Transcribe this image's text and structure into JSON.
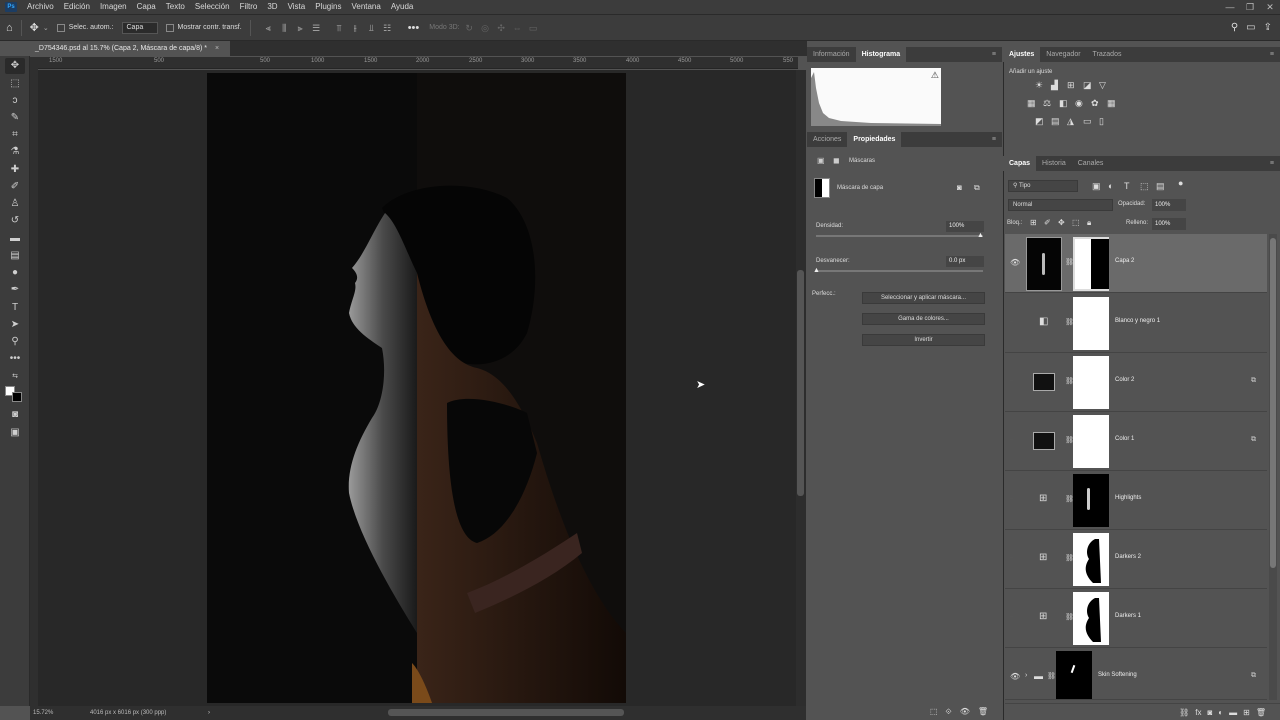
{
  "menu": [
    "Archivo",
    "Edición",
    "Imagen",
    "Capa",
    "Texto",
    "Selección",
    "Filtro",
    "3D",
    "Vista",
    "Plugins",
    "Ventana",
    "Ayuda"
  ],
  "options": {
    "auto_select_label": "Selec. autom.:",
    "auto_select_value": "Capa",
    "transform_label": "Mostrar contr. transf.",
    "mode3d_label": "Modo 3D:"
  },
  "document": {
    "tab_title": "_D754346.psd al 15.7% (Capa 2, Máscara de capa/8) *",
    "ruler_ticks": [
      "1500",
      "500",
      "500",
      "1000",
      "1500",
      "2000",
      "2500",
      "3000",
      "3500",
      "4000",
      "4500",
      "5000",
      "550"
    ]
  },
  "status": {
    "zoom": "15.72%",
    "doc_info": "4016 px x 6016 px (300 ppp)"
  },
  "histogram_panel": {
    "tabs": [
      "Información",
      "Histograma"
    ]
  },
  "properties_panel": {
    "tabs": [
      "Acciones",
      "Propiedades"
    ],
    "section": "Máscaras",
    "mask_label": "Máscara de capa",
    "density_label": "Densidad:",
    "density_value": "100%",
    "feather_label": "Desvanecer:",
    "feather_value": "0.0 px",
    "refine_label": "Perfecc.:",
    "btn_select_mask": "Seleccionar y aplicar máscara...",
    "btn_color_range": "Gama de colores...",
    "btn_invert": "Invertir"
  },
  "adjustments_panel": {
    "tabs": [
      "Ajustes",
      "Navegador",
      "Trazados"
    ],
    "add_label": "Añadir un ajuste"
  },
  "layers_panel": {
    "tabs": [
      "Capas",
      "Historia",
      "Canales"
    ],
    "filter_kind": "Tipo",
    "blend_mode": "Normal",
    "opacity_label": "Opacidad:",
    "opacity_value": "100%",
    "lock_label": "Bloq.:",
    "fill_label": "Relleno:",
    "fill_value": "100%",
    "layers": [
      {
        "name": "Capa 2",
        "visible": true,
        "selected": true
      },
      {
        "name": "Blanco y negro 1",
        "visible": false
      },
      {
        "name": "Color 2",
        "visible": false
      },
      {
        "name": "Color 1",
        "visible": false
      },
      {
        "name": "Highlights",
        "visible": false
      },
      {
        "name": "Darkers 2",
        "visible": false
      },
      {
        "name": "Darkers 1",
        "visible": false
      },
      {
        "name": "Skin Softening",
        "visible": true
      }
    ]
  },
  "colors": {
    "panel_bg": "#535353",
    "dark_bg": "#3c3c3c",
    "accent_ps": "#31a8ff"
  }
}
